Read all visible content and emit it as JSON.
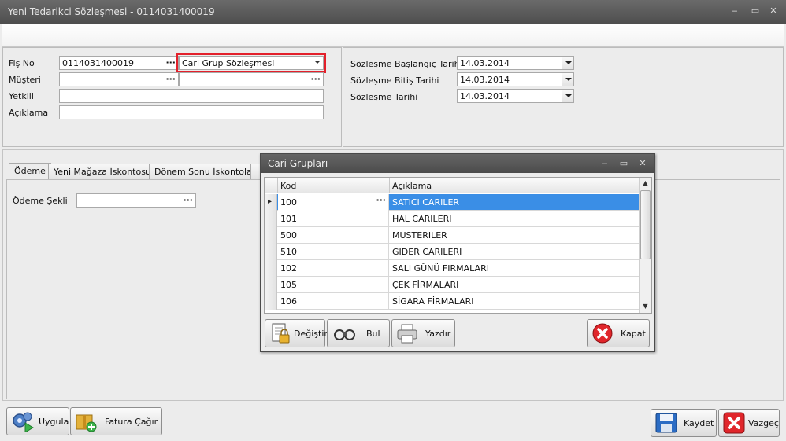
{
  "window": {
    "title": "Yeni Tedarikci Sözleşmesi - 0114031400019",
    "controls": {
      "minimize": "‒",
      "maximize": "▭",
      "close": "✕"
    }
  },
  "header_form": {
    "fis_no_label": "Fiş No",
    "fis_no_value": "0114031400019",
    "contract_type_value": "Cari Grup Sözleşmesi",
    "musteri_label": "Müşteri",
    "musteri_value": "",
    "musteri_extra_value": "",
    "yetkili_label": "Yetkili",
    "yetkili_value": "",
    "aciklama_label": "Açıklama",
    "aciklama_value": "",
    "ellipsis": "···"
  },
  "dates": {
    "baslangic_label": "Sözleşme Başlangıç Tarihi",
    "baslangic_value": "14.03.2014",
    "bitis_label": "Sözleşme Bitiş Tarihi",
    "bitis_value": "14.03.2014",
    "tarih_label": "Sözleşme Tarihi",
    "tarih_value": "14.03.2014"
  },
  "tabs": [
    {
      "label": "Ödeme",
      "active": true
    },
    {
      "label": "Yeni Mağaza İskontosu",
      "active": false
    },
    {
      "label": "Dönem Sonu İskontoları",
      "active": false
    }
  ],
  "odeme": {
    "odeme_sekli_label": "Ödeme Şekli",
    "odeme_sekli_value": ""
  },
  "bottom_buttons": {
    "uygula": "Uygula",
    "fatura_cagir": "Fatura Çağır",
    "kaydet": "Kaydet",
    "vazgec": "Vazgeç"
  },
  "dialog": {
    "title": "Cari Grupları",
    "columns": {
      "kod": "Kod",
      "aciklama": "Açıklama"
    },
    "rows": [
      {
        "kod": "100",
        "aciklama": "SATICI CARILER",
        "selected": true
      },
      {
        "kod": "101",
        "aciklama": "HAL CARILERI",
        "selected": false
      },
      {
        "kod": "500",
        "aciklama": "MUSTERILER",
        "selected": false
      },
      {
        "kod": "510",
        "aciklama": "GIDER CARILERI",
        "selected": false
      },
      {
        "kod": "102",
        "aciklama": "SALI GÜNÜ FIRMALARI",
        "selected": false
      },
      {
        "kod": "105",
        "aciklama": "ÇEK FİRMALARI",
        "selected": false
      },
      {
        "kod": "106",
        "aciklama": "SİGARA FİRMALARI",
        "selected": false
      }
    ],
    "buttons": {
      "degistir": "Değiştir",
      "bul": "Bul",
      "yazdir": "Yazdır",
      "kapat": "Kapat"
    }
  },
  "colors": {
    "highlight_box": "#e3202b",
    "selected_row": "#3a8ee6",
    "title_bar": "#555555"
  }
}
